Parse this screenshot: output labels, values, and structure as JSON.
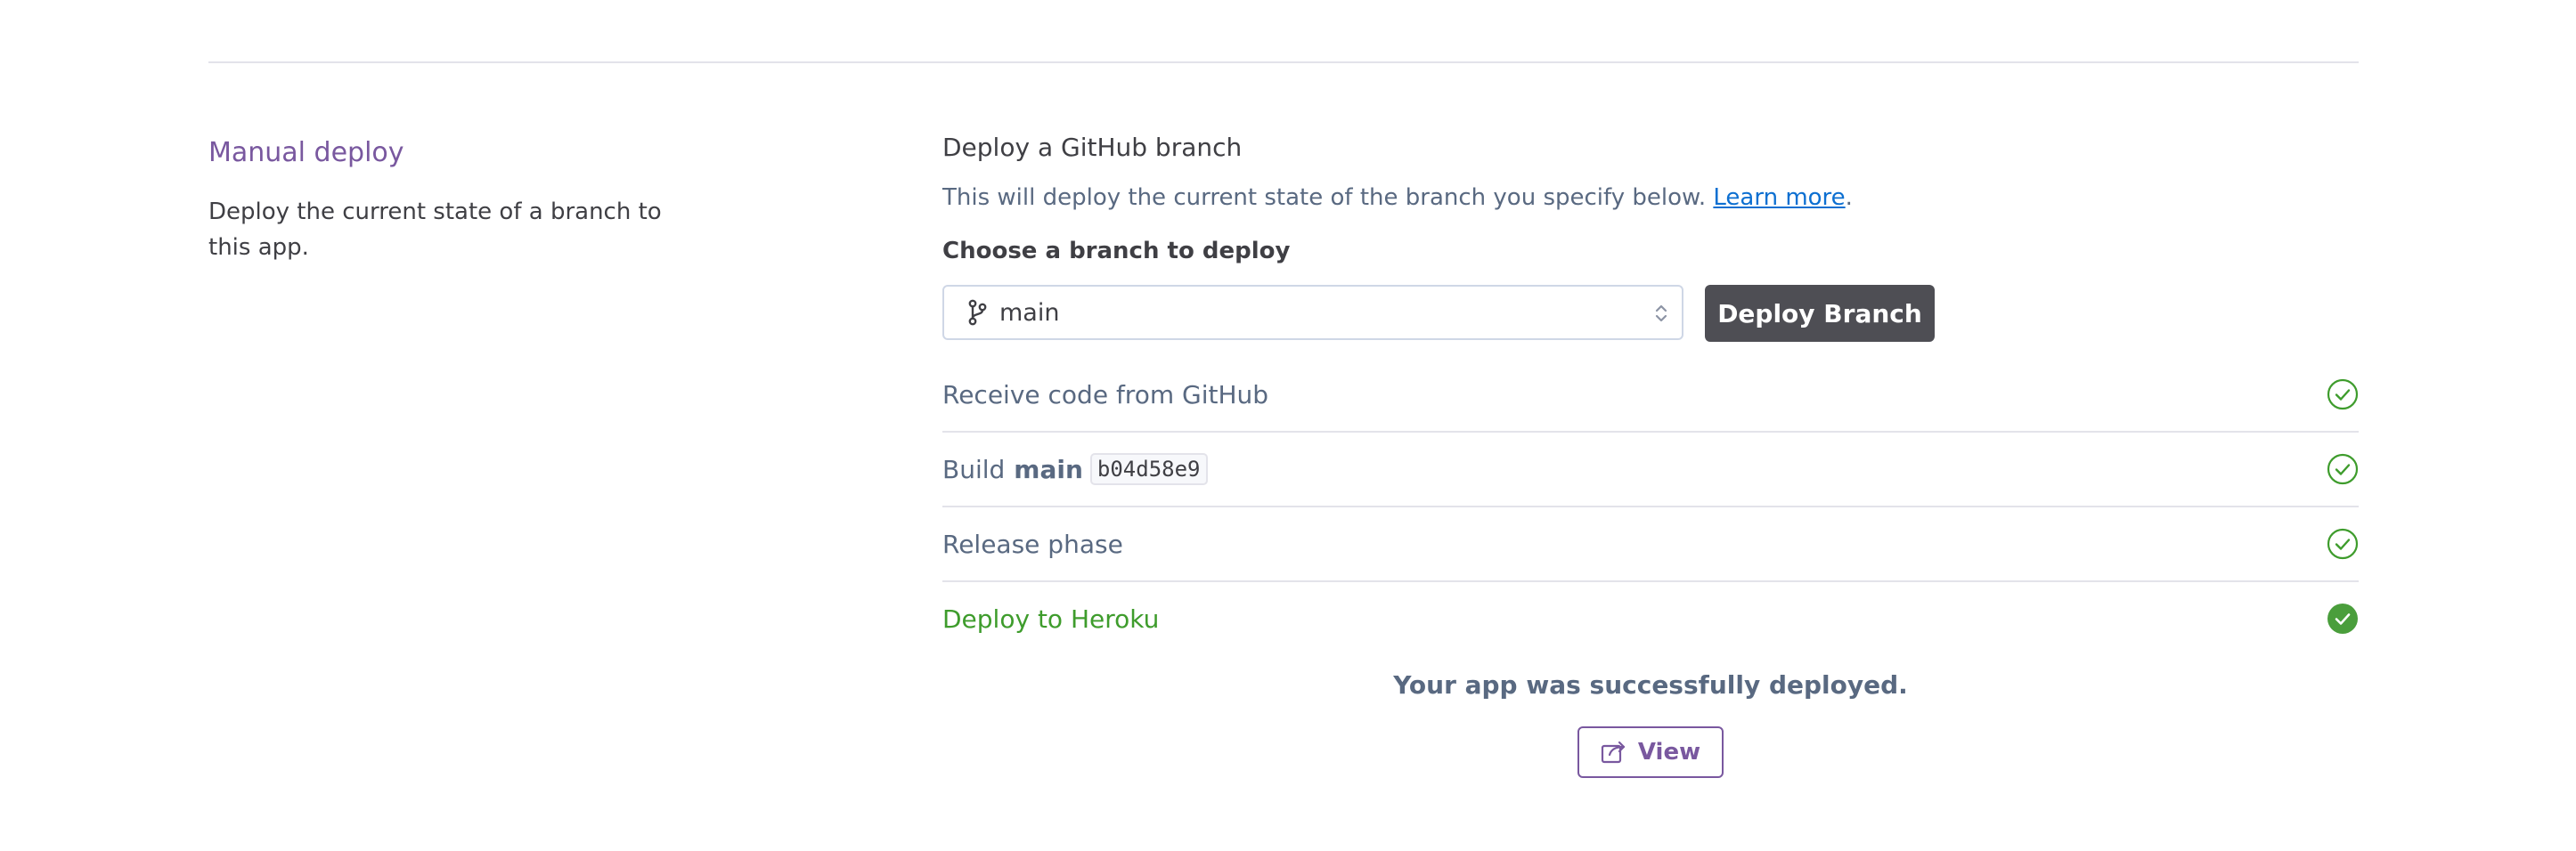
{
  "section": {
    "title": "Manual deploy",
    "description": "Deploy the current state of a branch to this app."
  },
  "deploy": {
    "title": "Deploy a GitHub branch",
    "description": "This will deploy the current state of the branch you specify below.",
    "learn_more": "Learn more",
    "description_end": ".",
    "choose_label": "Choose a branch to deploy",
    "branch_value": "main",
    "deploy_button": "Deploy Branch"
  },
  "steps": [
    {
      "label": "Receive code from GitHub",
      "status": "complete"
    },
    {
      "label": "Build",
      "branch": "main",
      "commit": "b04d58e9",
      "status": "complete"
    },
    {
      "label": "Release phase",
      "status": "complete"
    },
    {
      "label": "Deploy to Heroku",
      "status": "success"
    }
  ],
  "result": {
    "message": "Your app was successfully deployed.",
    "view_button": "View"
  },
  "colors": {
    "accent_purple": "#79589f",
    "success_green": "#3e9c2c",
    "button_dark": "#4e4e54",
    "link_blue": "#0c6fd1"
  },
  "icons": {
    "branch": "git-branch-icon",
    "select": "select-arrows-icon",
    "check_outline": "check-circle-outline-icon",
    "check_filled": "check-circle-filled-icon",
    "external": "external-link-icon"
  }
}
